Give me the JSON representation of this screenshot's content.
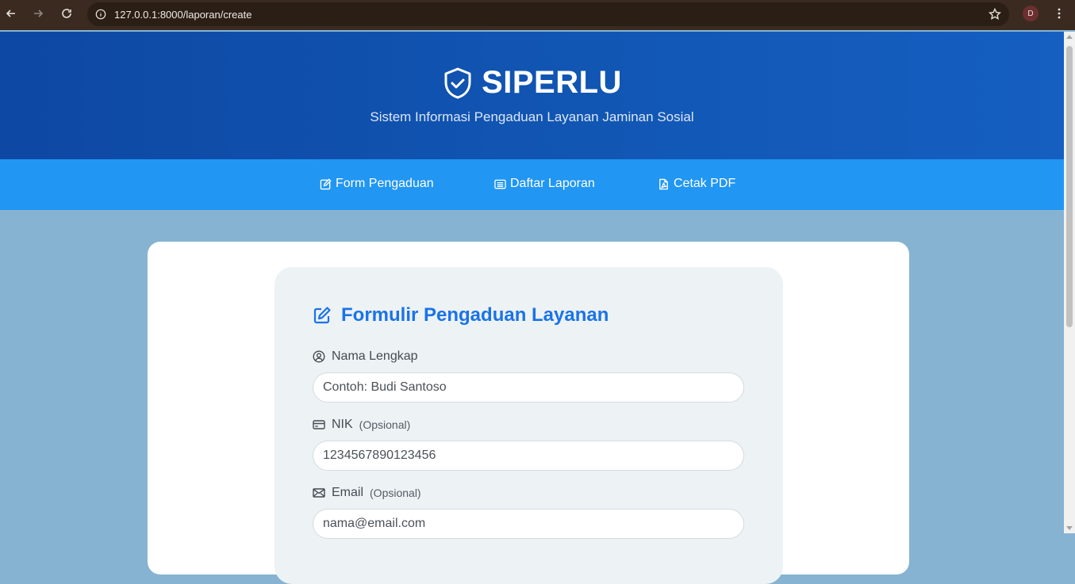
{
  "browser": {
    "url": "127.0.0.1:8000/laporan/create",
    "avatar_letter": "D"
  },
  "header": {
    "title": "SIPERLU",
    "subtitle": "Sistem Informasi Pengaduan Layanan Jaminan Sosial",
    "icon": "shield-check-icon"
  },
  "nav": {
    "items": [
      {
        "label": "Form Pengaduan",
        "icon": "edit-icon"
      },
      {
        "label": "Daftar Laporan",
        "icon": "list-icon"
      },
      {
        "label": "Cetak PDF",
        "icon": "pdf-icon"
      }
    ]
  },
  "form": {
    "title": "Formulir Pengaduan Layanan",
    "fields": [
      {
        "label": "Nama Lengkap",
        "optional": "",
        "placeholder": "Contoh: Budi Santoso",
        "icon": "user-circle-icon"
      },
      {
        "label": "NIK",
        "optional": "(Opsional)",
        "placeholder": "1234567890123456",
        "icon": "id-card-icon"
      },
      {
        "label": "Email",
        "optional": "(Opsional)",
        "placeholder": "nama@email.com",
        "icon": "envelope-icon"
      }
    ]
  },
  "colors": {
    "header_bg": "#0d48a3",
    "nav_bg": "#2196f3",
    "page_bg": "#86b3d2",
    "accent": "#1a73e8"
  }
}
